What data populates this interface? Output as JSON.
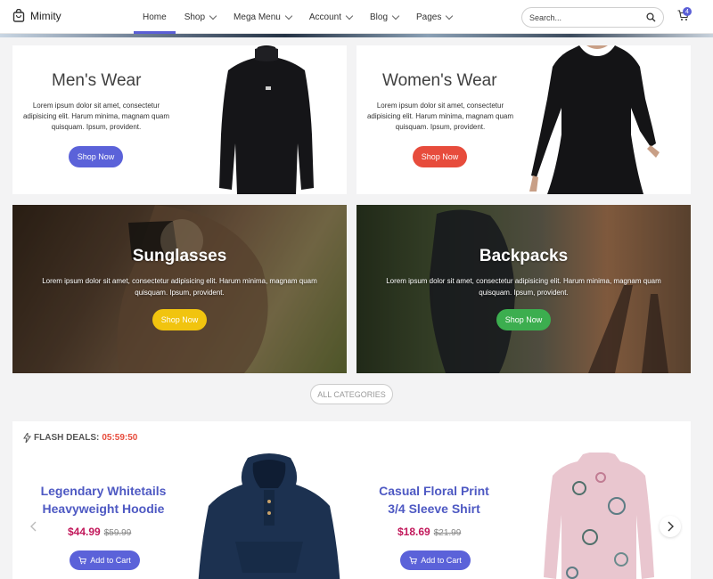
{
  "brand": {
    "name": "Mimity"
  },
  "nav": {
    "items": [
      {
        "label": "Home"
      },
      {
        "label": "Shop"
      },
      {
        "label": "Mega Menu"
      },
      {
        "label": "Account"
      },
      {
        "label": "Blog"
      },
      {
        "label": "Pages"
      }
    ]
  },
  "search": {
    "placeholder": "Search..."
  },
  "cart": {
    "count": "4"
  },
  "categories": {
    "mens": {
      "title": "Men's Wear",
      "text": "Lorem ipsum dolor sit amet, consectetur adipisicing elit. Harum minima, magnam quam quisquam. Ipsum, provident.",
      "button": "Shop Now",
      "color": "#5b62d9"
    },
    "womens": {
      "title": "Women's Wear",
      "text": "Lorem ipsum dolor sit amet, consectetur adipisicing elit. Harum minima, magnam quam quisquam. Ipsum, provident.",
      "button": "Shop Now",
      "color": "#e74c3c"
    },
    "sunglasses": {
      "title": "Sunglasses",
      "text": "Lorem ipsum dolor sit amet, consectetur adipisicing elit. Harum minima, magnam quam quisquam. Ipsum, provident.",
      "button": "Shop Now",
      "color": "#f1c40f"
    },
    "backpacks": {
      "title": "Backpacks",
      "text": "Lorem ipsum dolor sit amet, consectetur adipisicing elit. Harum minima, magnam quam quisquam. Ipsum, provident.",
      "button": "Shop Now",
      "color": "#3cae4f"
    }
  },
  "all_categories": "ALL CATEGORIES",
  "flash_deals": {
    "label": "FLASH DEALS:",
    "timer": "05:59:50",
    "products": [
      {
        "title_line1": "Legendary Whitetails",
        "title_line2": "Heavyweight Hoodie",
        "price": "$44.99",
        "old_price": "$59.99",
        "button": "Add to Cart"
      },
      {
        "title_line1": "Casual Floral Print",
        "title_line2": "3/4 Sleeve Shirt",
        "price": "$18.69",
        "old_price": "$21.99",
        "button": "Add to Cart"
      }
    ]
  }
}
